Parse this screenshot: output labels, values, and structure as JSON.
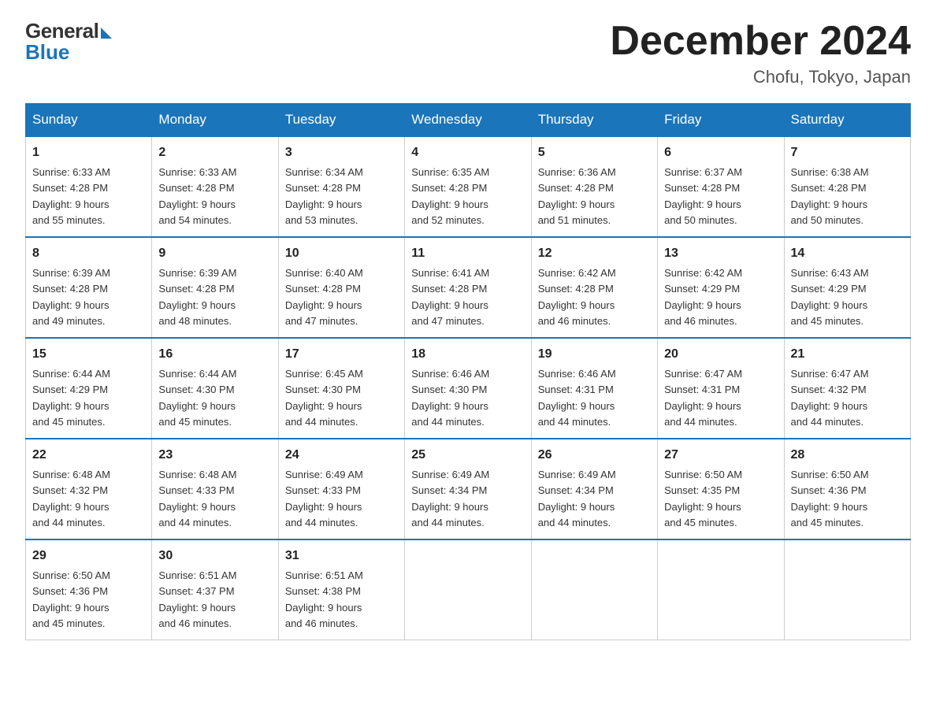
{
  "logo": {
    "general": "General",
    "blue": "Blue"
  },
  "title": "December 2024",
  "location": "Chofu, Tokyo, Japan",
  "days_of_week": [
    "Sunday",
    "Monday",
    "Tuesday",
    "Wednesday",
    "Thursday",
    "Friday",
    "Saturday"
  ],
  "weeks": [
    [
      {
        "day": "1",
        "sunrise": "6:33 AM",
        "sunset": "4:28 PM",
        "daylight": "9 hours and 55 minutes."
      },
      {
        "day": "2",
        "sunrise": "6:33 AM",
        "sunset": "4:28 PM",
        "daylight": "9 hours and 54 minutes."
      },
      {
        "day": "3",
        "sunrise": "6:34 AM",
        "sunset": "4:28 PM",
        "daylight": "9 hours and 53 minutes."
      },
      {
        "day": "4",
        "sunrise": "6:35 AM",
        "sunset": "4:28 PM",
        "daylight": "9 hours and 52 minutes."
      },
      {
        "day": "5",
        "sunrise": "6:36 AM",
        "sunset": "4:28 PM",
        "daylight": "9 hours and 51 minutes."
      },
      {
        "day": "6",
        "sunrise": "6:37 AM",
        "sunset": "4:28 PM",
        "daylight": "9 hours and 50 minutes."
      },
      {
        "day": "7",
        "sunrise": "6:38 AM",
        "sunset": "4:28 PM",
        "daylight": "9 hours and 50 minutes."
      }
    ],
    [
      {
        "day": "8",
        "sunrise": "6:39 AM",
        "sunset": "4:28 PM",
        "daylight": "9 hours and 49 minutes."
      },
      {
        "day": "9",
        "sunrise": "6:39 AM",
        "sunset": "4:28 PM",
        "daylight": "9 hours and 48 minutes."
      },
      {
        "day": "10",
        "sunrise": "6:40 AM",
        "sunset": "4:28 PM",
        "daylight": "9 hours and 47 minutes."
      },
      {
        "day": "11",
        "sunrise": "6:41 AM",
        "sunset": "4:28 PM",
        "daylight": "9 hours and 47 minutes."
      },
      {
        "day": "12",
        "sunrise": "6:42 AM",
        "sunset": "4:28 PM",
        "daylight": "9 hours and 46 minutes."
      },
      {
        "day": "13",
        "sunrise": "6:42 AM",
        "sunset": "4:29 PM",
        "daylight": "9 hours and 46 minutes."
      },
      {
        "day": "14",
        "sunrise": "6:43 AM",
        "sunset": "4:29 PM",
        "daylight": "9 hours and 45 minutes."
      }
    ],
    [
      {
        "day": "15",
        "sunrise": "6:44 AM",
        "sunset": "4:29 PM",
        "daylight": "9 hours and 45 minutes."
      },
      {
        "day": "16",
        "sunrise": "6:44 AM",
        "sunset": "4:30 PM",
        "daylight": "9 hours and 45 minutes."
      },
      {
        "day": "17",
        "sunrise": "6:45 AM",
        "sunset": "4:30 PM",
        "daylight": "9 hours and 44 minutes."
      },
      {
        "day": "18",
        "sunrise": "6:46 AM",
        "sunset": "4:30 PM",
        "daylight": "9 hours and 44 minutes."
      },
      {
        "day": "19",
        "sunrise": "6:46 AM",
        "sunset": "4:31 PM",
        "daylight": "9 hours and 44 minutes."
      },
      {
        "day": "20",
        "sunrise": "6:47 AM",
        "sunset": "4:31 PM",
        "daylight": "9 hours and 44 minutes."
      },
      {
        "day": "21",
        "sunrise": "6:47 AM",
        "sunset": "4:32 PM",
        "daylight": "9 hours and 44 minutes."
      }
    ],
    [
      {
        "day": "22",
        "sunrise": "6:48 AM",
        "sunset": "4:32 PM",
        "daylight": "9 hours and 44 minutes."
      },
      {
        "day": "23",
        "sunrise": "6:48 AM",
        "sunset": "4:33 PM",
        "daylight": "9 hours and 44 minutes."
      },
      {
        "day": "24",
        "sunrise": "6:49 AM",
        "sunset": "4:33 PM",
        "daylight": "9 hours and 44 minutes."
      },
      {
        "day": "25",
        "sunrise": "6:49 AM",
        "sunset": "4:34 PM",
        "daylight": "9 hours and 44 minutes."
      },
      {
        "day": "26",
        "sunrise": "6:49 AM",
        "sunset": "4:34 PM",
        "daylight": "9 hours and 44 minutes."
      },
      {
        "day": "27",
        "sunrise": "6:50 AM",
        "sunset": "4:35 PM",
        "daylight": "9 hours and 45 minutes."
      },
      {
        "day": "28",
        "sunrise": "6:50 AM",
        "sunset": "4:36 PM",
        "daylight": "9 hours and 45 minutes."
      }
    ],
    [
      {
        "day": "29",
        "sunrise": "6:50 AM",
        "sunset": "4:36 PM",
        "daylight": "9 hours and 45 minutes."
      },
      {
        "day": "30",
        "sunrise": "6:51 AM",
        "sunset": "4:37 PM",
        "daylight": "9 hours and 46 minutes."
      },
      {
        "day": "31",
        "sunrise": "6:51 AM",
        "sunset": "4:38 PM",
        "daylight": "9 hours and 46 minutes."
      },
      null,
      null,
      null,
      null
    ]
  ],
  "labels": {
    "sunrise": "Sunrise:",
    "sunset": "Sunset:",
    "daylight": "Daylight:"
  }
}
